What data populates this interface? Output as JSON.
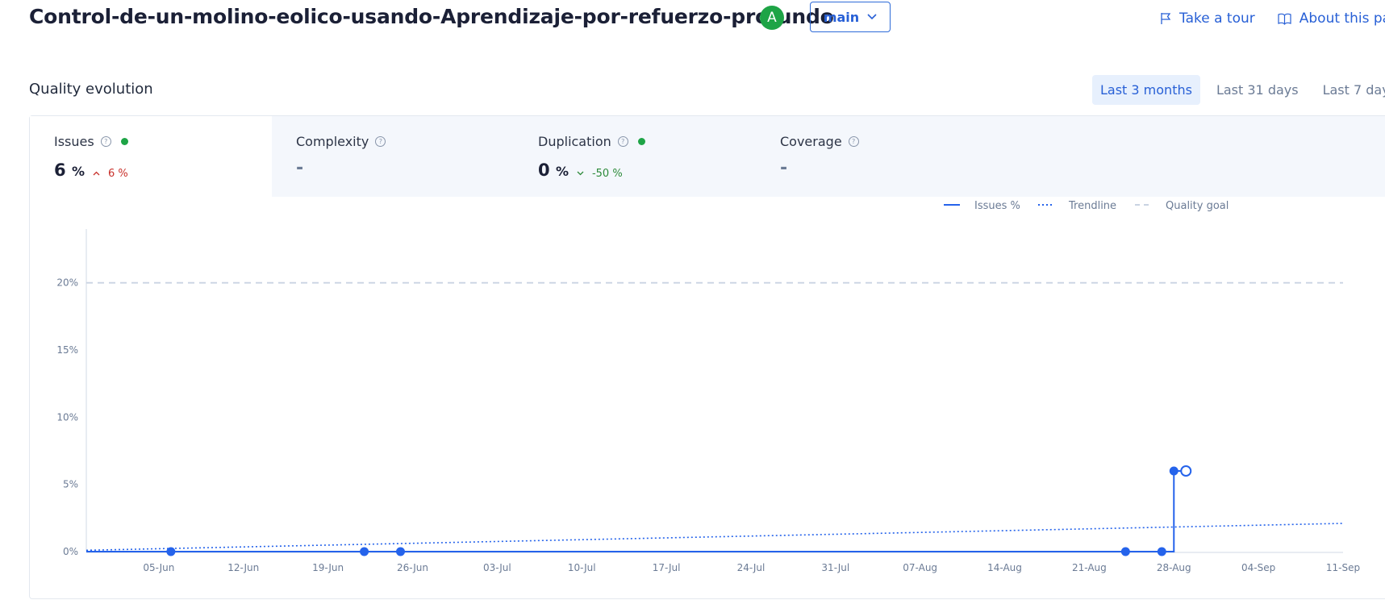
{
  "header": {
    "project_title": "Control-de-un-molino-eolico-usando-Aprendizaje-por-refuerzo-profundo",
    "grade": "A",
    "branch": "main",
    "take_tour": "Take a tour",
    "about_page": "About this pa"
  },
  "section_title": "Quality evolution",
  "range_options": [
    "Last 3 months",
    "Last 31 days",
    "Last 7 day"
  ],
  "metrics": {
    "issues": {
      "label": "Issues",
      "value": "6",
      "unit": "%",
      "delta": "6",
      "delta_unit": "%"
    },
    "complexity": {
      "label": "Complexity",
      "value": "-"
    },
    "duplication": {
      "label": "Duplication",
      "value": "0",
      "unit": "%",
      "delta": "-50",
      "delta_unit": "%"
    },
    "coverage": {
      "label": "Coverage",
      "value": "-"
    }
  },
  "colors": {
    "accent": "#2563eb",
    "good": "#1ea446",
    "bad": "#c8302a",
    "goal": "#c9d3e2"
  },
  "chart_data": {
    "type": "line",
    "legend": [
      "Issues %",
      "Trendline",
      "Quality goal"
    ],
    "legend_position": "top-right",
    "x_ticks": [
      "05-Jun",
      "12-Jun",
      "19-Jun",
      "26-Jun",
      "03-Jul",
      "10-Jul",
      "17-Jul",
      "24-Jul",
      "31-Jul",
      "07-Aug",
      "14-Aug",
      "21-Aug",
      "28-Aug",
      "04-Sep",
      "11-Sep"
    ],
    "y_ticks": [
      "0%",
      "5%",
      "10%",
      "15%",
      "20%"
    ],
    "ylim": [
      0,
      24
    ],
    "xlim": [
      "2023-05-30",
      "2023-09-11"
    ],
    "grid": false,
    "series": [
      {
        "name": "Issues %",
        "points": [
          {
            "x": "2023-06-06",
            "y": 0
          },
          {
            "x": "2023-06-22",
            "y": 0
          },
          {
            "x": "2023-06-25",
            "y": 0
          },
          {
            "x": "2023-08-24",
            "y": 0
          },
          {
            "x": "2023-08-27",
            "y": 0
          },
          {
            "x": "2023-08-28",
            "y": 6
          },
          {
            "x": "2023-08-29",
            "y": 6,
            "open": true
          }
        ]
      },
      {
        "name": "Trendline",
        "points": [
          {
            "x": "2023-05-30",
            "y": 0.1
          },
          {
            "x": "2023-09-11",
            "y": 2.1
          }
        ]
      },
      {
        "name": "Quality goal",
        "points": [
          {
            "x": "2023-05-30",
            "y": 20
          },
          {
            "x": "2023-09-11",
            "y": 20
          }
        ]
      }
    ]
  }
}
